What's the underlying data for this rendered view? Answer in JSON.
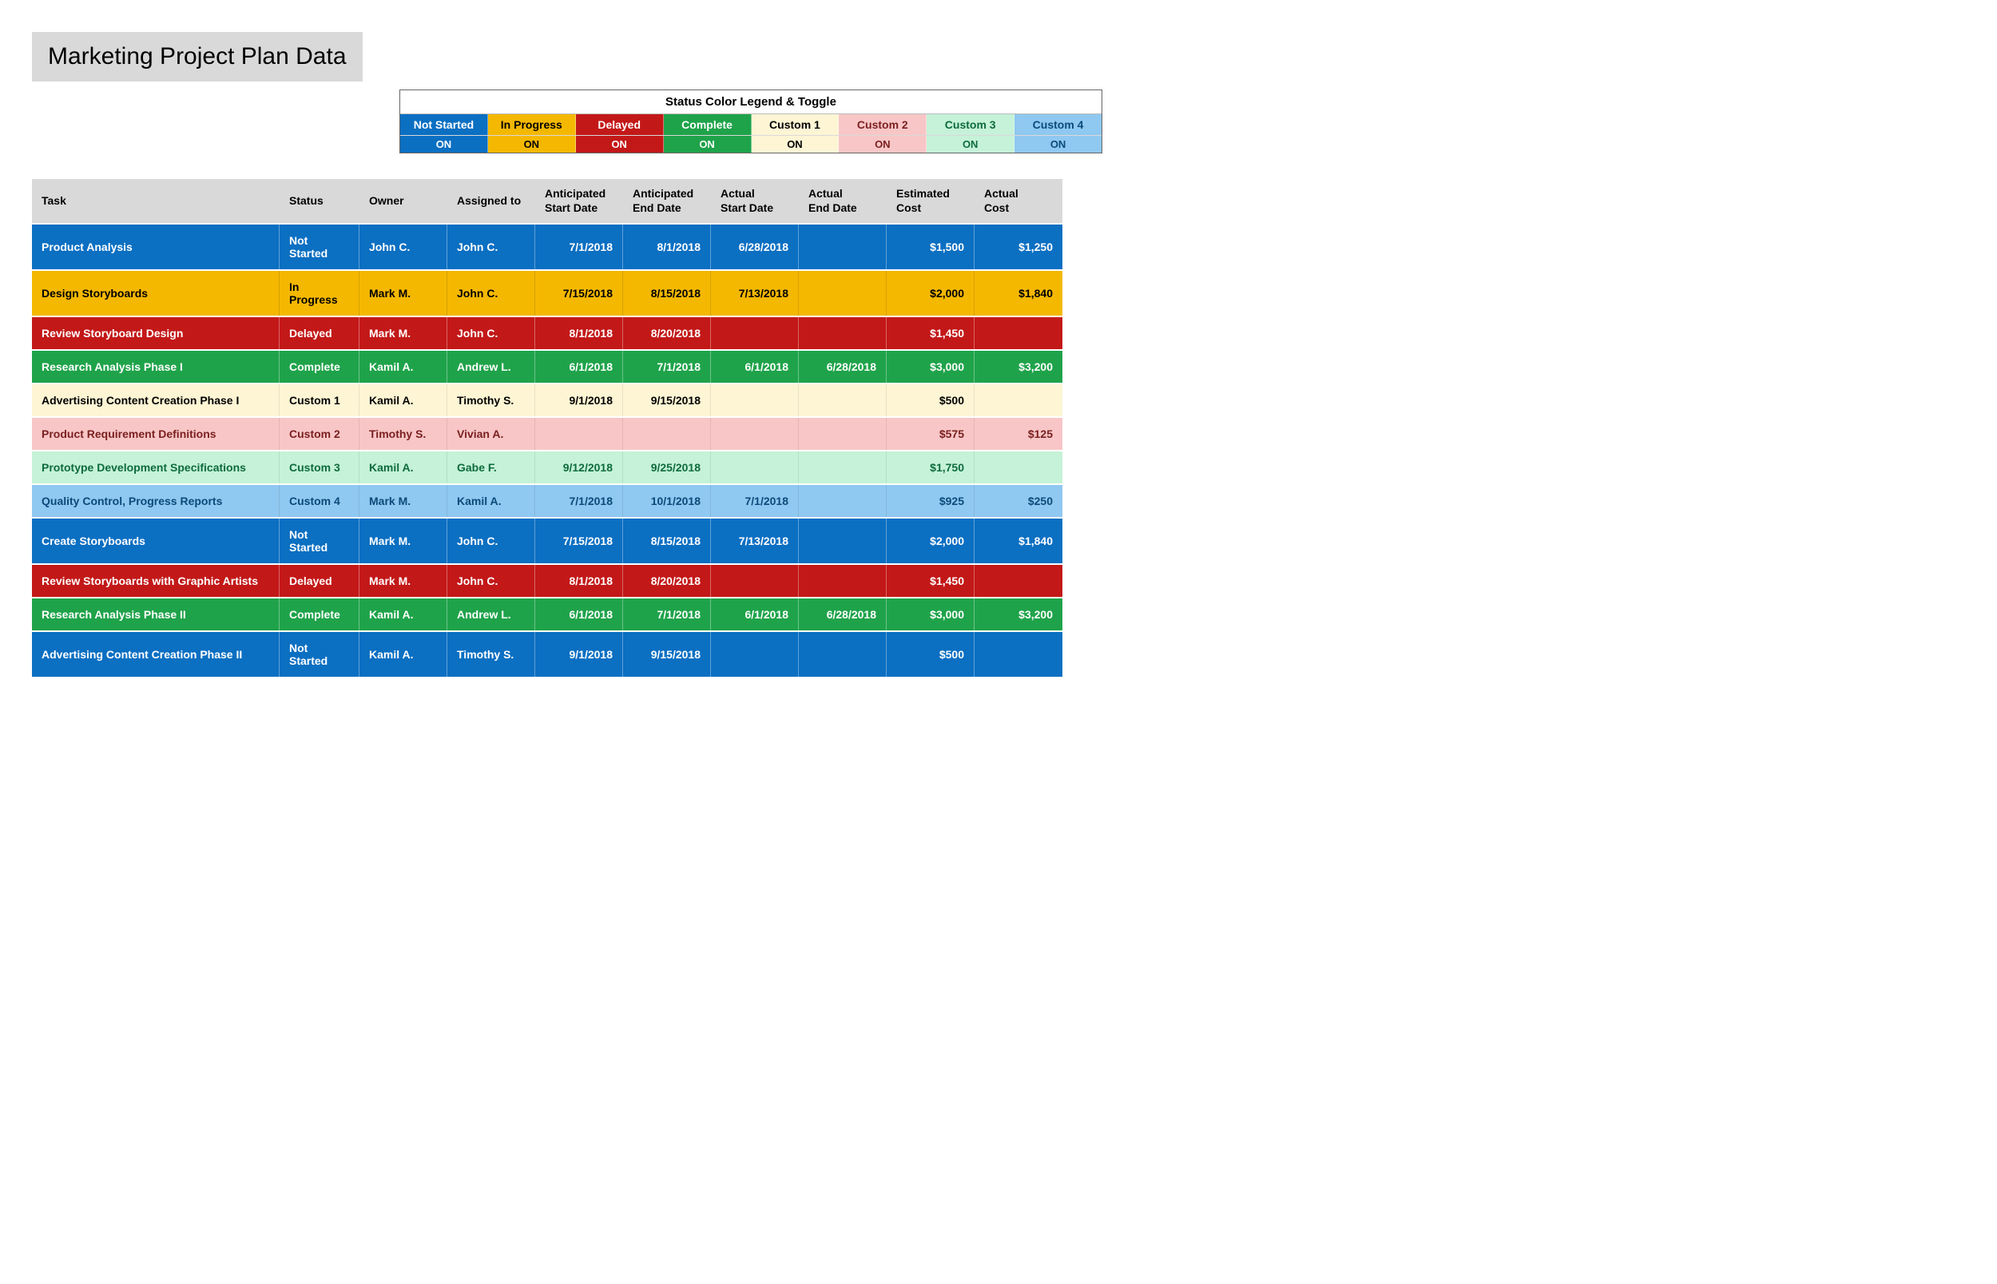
{
  "title": "Marketing Project Plan Data",
  "legend": {
    "title": "Status Color Legend & Toggle",
    "items": [
      {
        "label": "Not Started",
        "toggle": "ON",
        "cls": "s-not-started"
      },
      {
        "label": "In Progress",
        "toggle": "ON",
        "cls": "s-in-progress"
      },
      {
        "label": "Delayed",
        "toggle": "ON",
        "cls": "s-delayed"
      },
      {
        "label": "Complete",
        "toggle": "ON",
        "cls": "s-complete"
      },
      {
        "label": "Custom 1",
        "toggle": "ON",
        "cls": "s-custom1"
      },
      {
        "label": "Custom 2",
        "toggle": "ON",
        "cls": "s-custom2"
      },
      {
        "label": "Custom 3",
        "toggle": "ON",
        "cls": "s-custom3"
      },
      {
        "label": "Custom 4",
        "toggle": "ON",
        "cls": "s-custom4"
      }
    ]
  },
  "columns": [
    "Task",
    "Status",
    "Owner",
    "Assigned to",
    "Anticipated\nStart Date",
    "Anticipated\nEnd Date",
    "Actual\nStart Date",
    "Actual\nEnd Date",
    "Estimated\nCost",
    "Actual\nCost"
  ],
  "rows": [
    {
      "task": "Product Analysis",
      "status": "Not Started",
      "owner": "John C.",
      "assigned": "John C.",
      "antStart": "7/1/2018",
      "antEnd": "8/1/2018",
      "actStart": "6/28/2018",
      "actEnd": "",
      "estCost": "$1,500",
      "actCost": "$1,250",
      "cls": "s-not-started"
    },
    {
      "task": "Design Storyboards",
      "status": "In Progress",
      "owner": "Mark M.",
      "assigned": "John C.",
      "antStart": "7/15/2018",
      "antEnd": "8/15/2018",
      "actStart": "7/13/2018",
      "actEnd": "",
      "estCost": "$2,000",
      "actCost": "$1,840",
      "cls": "s-in-progress"
    },
    {
      "task": "Review Storyboard Design",
      "status": "Delayed",
      "owner": "Mark M.",
      "assigned": "John C.",
      "antStart": "8/1/2018",
      "antEnd": "8/20/2018",
      "actStart": "",
      "actEnd": "",
      "estCost": "$1,450",
      "actCost": "",
      "cls": "s-delayed"
    },
    {
      "task": "Research Analysis Phase I",
      "status": "Complete",
      "owner": "Kamil A.",
      "assigned": "Andrew L.",
      "antStart": "6/1/2018",
      "antEnd": "7/1/2018",
      "actStart": "6/1/2018",
      "actEnd": "6/28/2018",
      "estCost": "$3,000",
      "actCost": "$3,200",
      "cls": "s-complete"
    },
    {
      "task": "Advertising Content Creation Phase I",
      "status": "Custom 1",
      "owner": "Kamil A.",
      "assigned": "Timothy S.",
      "antStart": "9/1/2018",
      "antEnd": "9/15/2018",
      "actStart": "",
      "actEnd": "",
      "estCost": "$500",
      "actCost": "",
      "cls": "s-custom1"
    },
    {
      "task": "Product Requirement Definitions",
      "status": "Custom 2",
      "owner": "Timothy S.",
      "assigned": "Vivian A.",
      "antStart": "",
      "antEnd": "",
      "actStart": "",
      "actEnd": "",
      "estCost": "$575",
      "actCost": "$125",
      "cls": "s-custom2"
    },
    {
      "task": "Prototype Development Specifications",
      "status": "Custom 3",
      "owner": "Kamil A.",
      "assigned": "Gabe F.",
      "antStart": "9/12/2018",
      "antEnd": "9/25/2018",
      "actStart": "",
      "actEnd": "",
      "estCost": "$1,750",
      "actCost": "",
      "cls": "s-custom3"
    },
    {
      "task": "Quality Control, Progress Reports",
      "status": "Custom 4",
      "owner": "Mark M.",
      "assigned": "Kamil A.",
      "antStart": "7/1/2018",
      "antEnd": "10/1/2018",
      "actStart": "7/1/2018",
      "actEnd": "",
      "estCost": "$925",
      "actCost": "$250",
      "cls": "s-custom4"
    },
    {
      "task": "Create Storyboards",
      "status": "Not Started",
      "owner": "Mark M.",
      "assigned": "John C.",
      "antStart": "7/15/2018",
      "antEnd": "8/15/2018",
      "actStart": "7/13/2018",
      "actEnd": "",
      "estCost": "$2,000",
      "actCost": "$1,840",
      "cls": "s-not-started"
    },
    {
      "task": "Review Storyboards with Graphic Artists",
      "status": "Delayed",
      "owner": "Mark M.",
      "assigned": "John C.",
      "antStart": "8/1/2018",
      "antEnd": "8/20/2018",
      "actStart": "",
      "actEnd": "",
      "estCost": "$1,450",
      "actCost": "",
      "cls": "s-delayed"
    },
    {
      "task": "Research Analysis Phase II",
      "status": "Complete",
      "owner": "Kamil A.",
      "assigned": "Andrew L.",
      "antStart": "6/1/2018",
      "antEnd": "7/1/2018",
      "actStart": "6/1/2018",
      "actEnd": "6/28/2018",
      "estCost": "$3,000",
      "actCost": "$3,200",
      "cls": "s-complete"
    },
    {
      "task": "Advertising Content Creation Phase II",
      "status": "Not Started",
      "owner": "Kamil A.",
      "assigned": "Timothy S.",
      "antStart": "9/1/2018",
      "antEnd": "9/15/2018",
      "actStart": "",
      "actEnd": "",
      "estCost": "$500",
      "actCost": "",
      "cls": "s-not-started"
    }
  ]
}
